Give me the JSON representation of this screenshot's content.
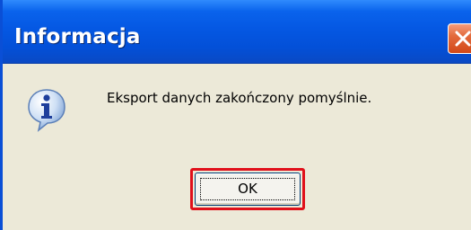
{
  "dialog": {
    "title": "Informacja",
    "message": "Eksport danych zakończony pomyślnie.",
    "ok_label": "OK",
    "icon": "info-icon",
    "close_icon": "close-icon"
  },
  "colors": {
    "titlebar": "#0558e3",
    "body": "#ece9d8",
    "close_button": "#e36b3d",
    "highlight": "#e0101a"
  }
}
